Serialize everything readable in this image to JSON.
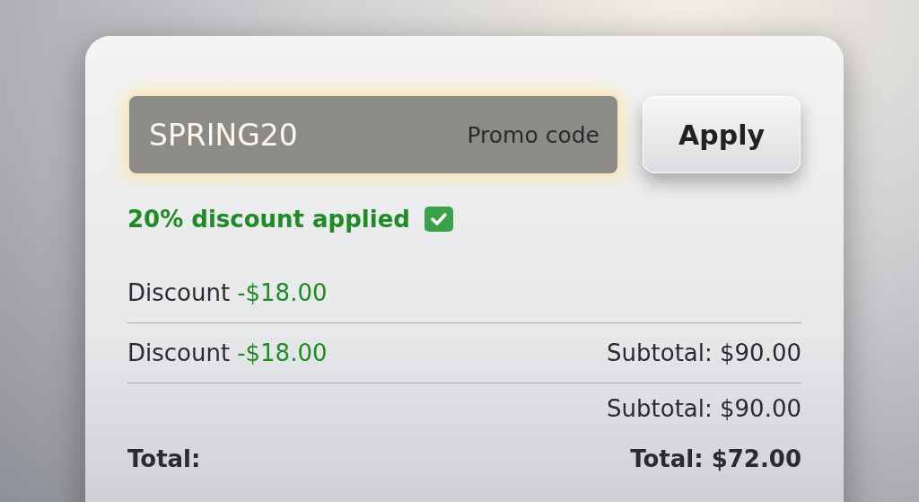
{
  "promo_field": {
    "value": "SPRING20",
    "label": "Promo code"
  },
  "apply_button": {
    "label": "Apply"
  },
  "status": {
    "text": "20% discount applied",
    "checked": true
  },
  "rows": [
    {
      "label": "Discount",
      "amount": "-$18.00",
      "divider": true
    },
    {
      "label": "Discount",
      "amount": "-$18.00",
      "right": "Subtotal: $90.00",
      "divider": true
    },
    {
      "right": "Subtotal: $90.00",
      "divider": false
    },
    {
      "label": "Total:",
      "right": "Total: $72.00",
      "bold": true,
      "divider": false
    }
  ]
}
